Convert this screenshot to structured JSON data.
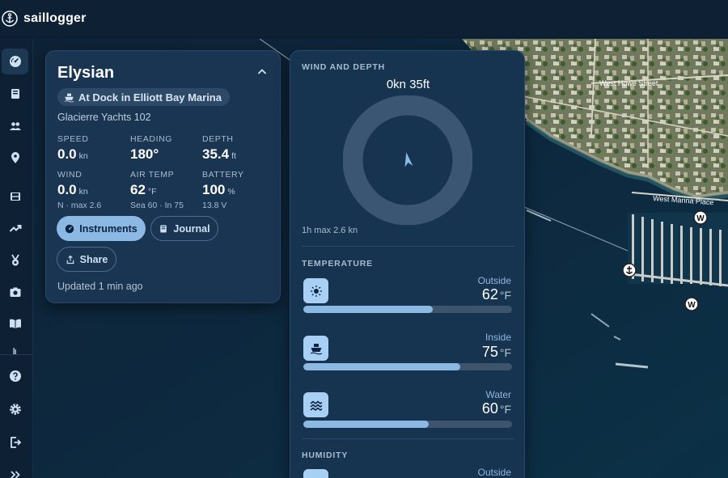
{
  "app": {
    "name": "saillogger"
  },
  "sidebar": {
    "items": [
      {
        "icon": "dashboard-icon",
        "active": true
      },
      {
        "icon": "logbook-icon"
      },
      {
        "icon": "crew-icon"
      },
      {
        "icon": "location-pin-icon"
      },
      {
        "icon": "film-icon"
      },
      {
        "icon": "trending-icon"
      },
      {
        "icon": "medal-icon"
      },
      {
        "icon": "camera-icon"
      },
      {
        "icon": "book-open-icon"
      },
      {
        "icon": "help-icon"
      },
      {
        "icon": "settings-icon"
      },
      {
        "icon": "logout-icon"
      },
      {
        "icon": "expand-icon"
      }
    ]
  },
  "map": {
    "labels": {
      "street_top": "West Howe Street",
      "street_marina": "West Marina Place",
      "street_vertical": "Street"
    },
    "markers": [
      "W",
      "W",
      "anchor"
    ]
  },
  "boat_card": {
    "name": "Elysian",
    "status": "At Dock in Elliott Bay Marina",
    "model": "Glacierre Yachts 102",
    "stats": {
      "speed": {
        "label": "SPEED",
        "value": "0.0",
        "unit": "kn"
      },
      "heading": {
        "label": "HEADING",
        "value": "180°"
      },
      "depth": {
        "label": "DEPTH",
        "value": "35.4",
        "unit": "ft"
      },
      "wind": {
        "label": "WIND",
        "value": "0.0",
        "unit": "kn",
        "sub": "N · max 2.6"
      },
      "air_temp": {
        "label": "AIR TEMP",
        "value": "62",
        "unit": "°F",
        "sub": "Sea 60 · In 75"
      },
      "battery": {
        "label": "BATTERY",
        "value": "100",
        "unit": "%",
        "sub": "13.8 V"
      }
    },
    "buttons": {
      "instruments": "Instruments",
      "journal": "Journal",
      "share": "Share"
    },
    "updated": "Updated 1 min ago"
  },
  "instruments": {
    "wind_depth": {
      "title": "WIND AND DEPTH",
      "readout": "0kn  35ft",
      "max": "1h max 2.6 kn"
    },
    "temperature": {
      "title": "TEMPERATURE",
      "items": [
        {
          "label": "Outside",
          "value": "62",
          "unit": "°F",
          "fill": 0.62,
          "icon": "sun-icon"
        },
        {
          "label": "Inside",
          "value": "75",
          "unit": "°F",
          "fill": 0.75,
          "icon": "boat-icon"
        },
        {
          "label": "Water",
          "value": "60",
          "unit": "°F",
          "fill": 0.6,
          "icon": "water-icon"
        }
      ]
    },
    "humidity": {
      "title": "HUMIDITY",
      "items": [
        {
          "label": "Outside"
        }
      ]
    }
  },
  "colors": {
    "accent": "#8bb9e4",
    "background": "#0f2236",
    "card": "#1a3552"
  }
}
